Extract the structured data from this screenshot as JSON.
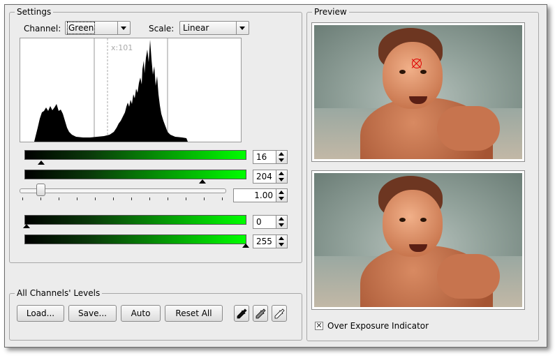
{
  "settings": {
    "title": "Settings",
    "channel_label": "Channel:",
    "channel_value": "Green",
    "scale_label": "Scale:",
    "scale_value": "Linear",
    "histogram": {
      "cursor_label": "x:101",
      "low_input_fraction": 0.0627,
      "high_input_fraction": 0.8,
      "cursor_fraction": 0.396
    },
    "input_low": "16",
    "input_high": "204",
    "gamma": "1.00",
    "gamma_fraction": 0.1,
    "output_low": "0",
    "output_high": "255"
  },
  "all_channels": {
    "title": "All Channels' Levels",
    "load_label": "Load...",
    "save_label": "Save...",
    "auto_label": "Auto",
    "reset_label": "Reset All"
  },
  "preview": {
    "title": "Preview",
    "overexposure_label": "Over Exposure Indicator",
    "overexposure_checked": true,
    "checkbox_mark": "✕"
  },
  "colors": {
    "gradient_end": "#00ff00",
    "marker": "#e00000"
  }
}
